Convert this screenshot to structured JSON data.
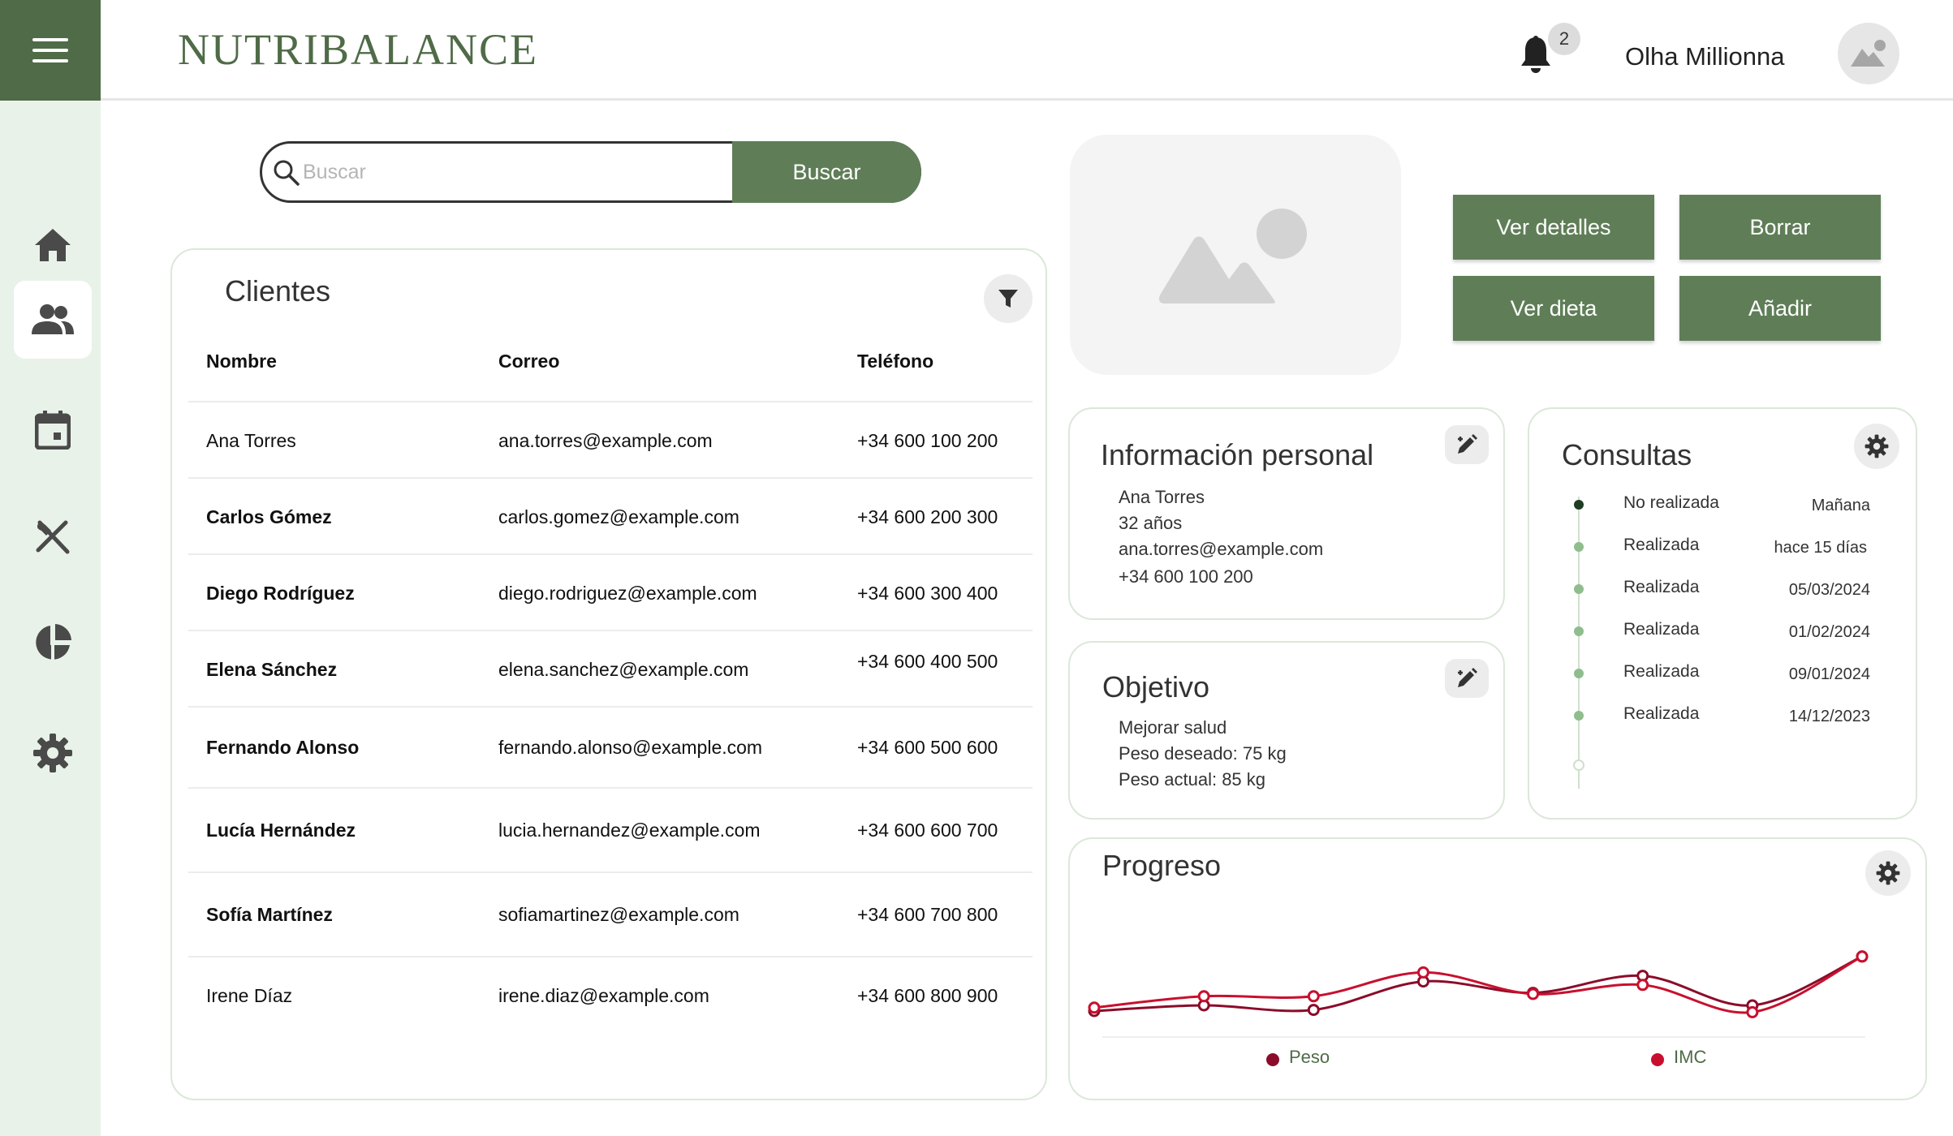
{
  "brand": "NUTRIBALANCE",
  "header": {
    "notifications_count": "2",
    "user_name": "Olha Millionna"
  },
  "sidebar": {
    "items": [
      {
        "name": "home",
        "icon": "home-icon"
      },
      {
        "name": "clients",
        "icon": "users-icon",
        "active": true
      },
      {
        "name": "calendar",
        "icon": "calendar-icon"
      },
      {
        "name": "diet",
        "icon": "utensils-icon"
      },
      {
        "name": "stats",
        "icon": "pie-chart-icon"
      },
      {
        "name": "settings",
        "icon": "gear-icon"
      }
    ]
  },
  "search": {
    "placeholder": "Buscar",
    "button_label": "Buscar"
  },
  "clients": {
    "title": "Clientes",
    "columns": [
      "Nombre",
      "Correo",
      "Teléfono"
    ],
    "rows": [
      {
        "name": "Ana Torres",
        "email": "ana.torres@example.com",
        "phone": "+34 600 100 200"
      },
      {
        "name": "Carlos Gómez",
        "email": "carlos.gomez@example.com",
        "phone": "+34 600 200 300"
      },
      {
        "name": "Diego Rodríguez",
        "email": "diego.rodriguez@example.com",
        "phone": "+34 600 300 400"
      },
      {
        "name": "Elena Sánchez",
        "email": "elena.sanchez@example.com",
        "phone": "+34 600 400 500"
      },
      {
        "name": "Fernando Alonso",
        "email": "fernando.alonso@example.com",
        "phone": "+34 600 500 600"
      },
      {
        "name": "Lucía Hernández",
        "email": "lucia.hernandez@example.com",
        "phone": "+34 600 600 700"
      },
      {
        "name": "Sofía Martínez",
        "email": "sofiamartinez@example.com",
        "phone": "+34 600 700 800"
      },
      {
        "name": "Irene Díaz",
        "email": "irene.diaz@example.com",
        "phone": "+34 600 800 900"
      }
    ]
  },
  "actions": {
    "details": "Ver detalles",
    "delete": "Borrar",
    "diet": "Ver dieta",
    "add": "Añadir"
  },
  "personal_info": {
    "title": "Información personal",
    "name": "Ana Torres",
    "age": "32 años",
    "email": "ana.torres@example.com",
    "phone": "+34 600 100 200"
  },
  "goal": {
    "title": "Objetivo",
    "objective": "Mejorar salud",
    "desired_weight": "Peso deseado: 75 kg",
    "current_weight": "Peso actual: 85 kg"
  },
  "consultations": {
    "title": "Consultas",
    "items": [
      {
        "status": "No realizada",
        "date": "Mañana"
      },
      {
        "status": "Realizada",
        "date": "hace 15 días"
      },
      {
        "status": "Realizada",
        "date": "05/03/2024"
      },
      {
        "status": "Realizada",
        "date": "01/02/2024"
      },
      {
        "status": "Realizada",
        "date": "09/01/2024"
      },
      {
        "status": "Realizada",
        "date": "14/12/2023"
      }
    ]
  },
  "colors": {
    "brand_green": "#4f6b47",
    "button_green": "#5f7e57",
    "sidebar_bg": "#e9f2e9",
    "peso": "#8b0c2a",
    "imc": "#c8102e"
  },
  "chart_data": {
    "type": "line",
    "title": "Progreso",
    "legend_position": "bottom",
    "grid": false,
    "x": [
      1,
      2,
      3,
      4,
      5,
      6,
      7,
      8
    ],
    "ylim": [
      0,
      100
    ],
    "series": [
      {
        "name": "Peso",
        "color": "#8b0c2a",
        "values": [
          20,
          25,
          21,
          46,
          36,
          51,
          25,
          68
        ]
      },
      {
        "name": "IMC",
        "color": "#c8102e",
        "values": [
          23,
          33,
          33,
          54,
          35,
          43,
          19,
          68
        ]
      }
    ]
  }
}
